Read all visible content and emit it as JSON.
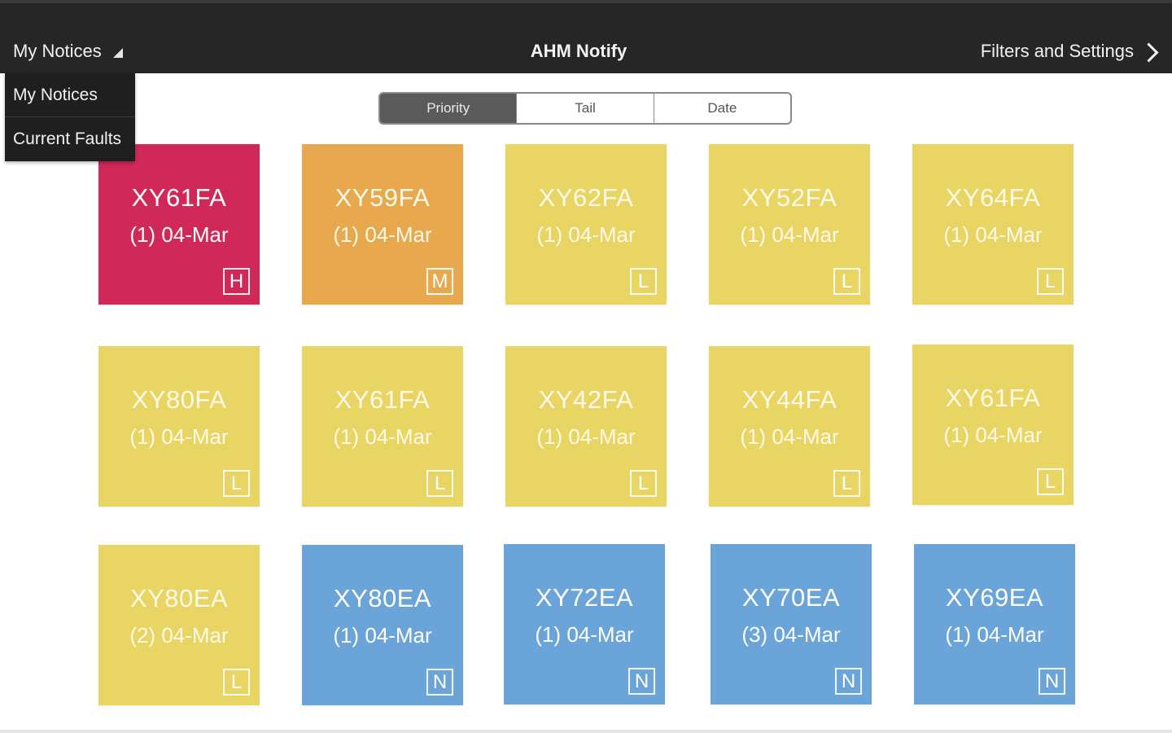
{
  "header": {
    "menu_label": "My Notices",
    "title": "AHM Notify",
    "settings_label": "Filters and Settings"
  },
  "dropdown": {
    "items": [
      "My Notices",
      "Current Faults"
    ]
  },
  "sort_tabs": {
    "items": [
      "Priority",
      "Tail",
      "Date"
    ],
    "selected": "Priority"
  },
  "priority_colors": {
    "H": "#d1285a",
    "M": "#e8a84e",
    "L": "#e9d563",
    "N": "#6aa4d8"
  },
  "tiles": [
    {
      "tail": "XY61FA",
      "sub": "(1) 04-Mar",
      "priority": "H"
    },
    {
      "tail": "XY59FA",
      "sub": "(1) 04-Mar",
      "priority": "M"
    },
    {
      "tail": "XY62FA",
      "sub": "(1) 04-Mar",
      "priority": "L"
    },
    {
      "tail": "XY52FA",
      "sub": "(1) 04-Mar",
      "priority": "L"
    },
    {
      "tail": "XY64FA",
      "sub": "(1) 04-Mar",
      "priority": "L"
    },
    {
      "tail": "XY80FA",
      "sub": "(1) 04-Mar",
      "priority": "L"
    },
    {
      "tail": "XY61FA",
      "sub": "(1) 04-Mar",
      "priority": "L"
    },
    {
      "tail": "XY42FA",
      "sub": "(1) 04-Mar",
      "priority": "L"
    },
    {
      "tail": "XY44FA",
      "sub": "(1) 04-Mar",
      "priority": "L"
    },
    {
      "tail": "XY61FA",
      "sub": "(1) 04-Mar",
      "priority": "L"
    },
    {
      "tail": "XY80EA",
      "sub": "(2) 04-Mar",
      "priority": "L"
    },
    {
      "tail": "XY80EA",
      "sub": "(1) 04-Mar",
      "priority": "N"
    },
    {
      "tail": "XY72EA",
      "sub": "(1) 04-Mar",
      "priority": "N"
    },
    {
      "tail": "XY70EA",
      "sub": "(3) 04-Mar",
      "priority": "N"
    },
    {
      "tail": "XY69EA",
      "sub": "(1) 04-Mar",
      "priority": "N"
    }
  ]
}
